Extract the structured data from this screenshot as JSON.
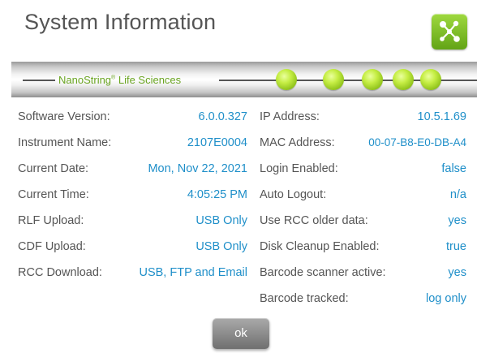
{
  "dialog": {
    "title": "System Information",
    "network_icon": "network-nodes-icon",
    "accent_green": "#8ec11a",
    "value_color": "#1f8fc9"
  },
  "banner": {
    "brand_name": "NanoString",
    "brand_mark": "®",
    "brand_suffix": "Life Sciences"
  },
  "left": [
    {
      "label": "Software Version:",
      "value": "6.0.0.327"
    },
    {
      "label": "Instrument Name:",
      "value": "2107E0004"
    },
    {
      "label": "Current Date:",
      "value": "Mon, Nov 22, 2021"
    },
    {
      "label": "Current Time:",
      "value": "4:05:25 PM"
    },
    {
      "label": "RLF Upload:",
      "value": "USB Only"
    },
    {
      "label": "CDF Upload:",
      "value": "USB Only"
    },
    {
      "label": "RCC Download:",
      "value": "USB, FTP and Email"
    }
  ],
  "right": [
    {
      "label": "IP Address:",
      "value": "10.5.1.69"
    },
    {
      "label": "MAC Address:",
      "value": "00-07-B8-E0-DB-A4"
    },
    {
      "label": "Login Enabled:",
      "value": "false"
    },
    {
      "label": "Auto Logout:",
      "value": "n/a"
    },
    {
      "label": "Use RCC older data:",
      "value": "yes"
    },
    {
      "label": "Disk Cleanup Enabled:",
      "value": "true"
    },
    {
      "label": "Barcode scanner active:",
      "value": "yes"
    },
    {
      "label": "Barcode tracked:",
      "value": "log only"
    }
  ],
  "footer": {
    "ok_label": "ok"
  }
}
